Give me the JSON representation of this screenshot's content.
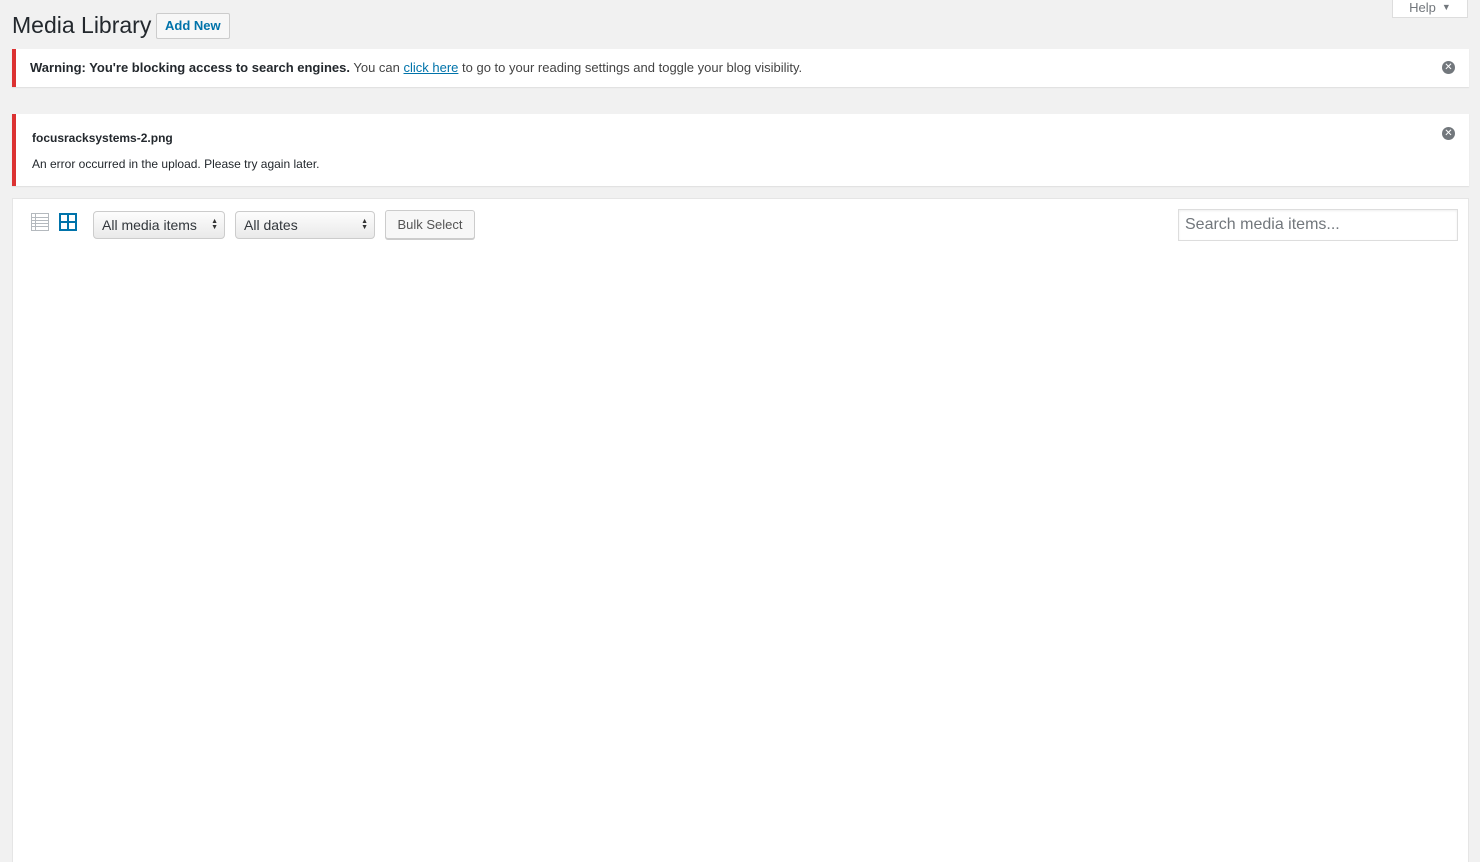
{
  "header": {
    "title": "Media Library",
    "add_new_label": "Add New",
    "help_label": "Help"
  },
  "notices": {
    "warning": {
      "strong": "Warning: You're blocking access to search engines.",
      "before_link": " You can ",
      "link_text": "click here",
      "after_link": " to go to your reading settings and toggle your blog visibility."
    },
    "upload_error": {
      "filename": "focusracksystems-2.png",
      "message": "An error occurred in the upload. Please try again later."
    }
  },
  "toolbar": {
    "type_filter_selected": "All media items",
    "date_filter_selected": "All dates",
    "bulk_select_label": "Bulk Select",
    "search_placeholder": "Search media items..."
  },
  "icons": {
    "list_view": "list-view-icon",
    "grid_view": "grid-view-icon",
    "dismiss": "dismiss-icon",
    "help_arrow": "caret-down-icon"
  },
  "colors": {
    "accent": "#0073aa",
    "error_border": "#dc3232",
    "background": "#f1f1f1"
  }
}
